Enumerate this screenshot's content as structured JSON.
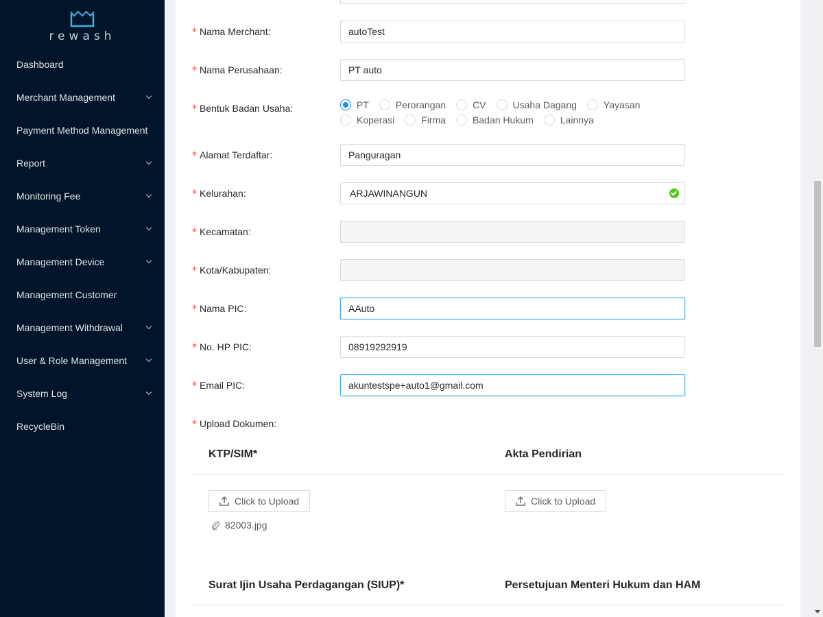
{
  "brand": {
    "name": "rewash",
    "color": "#3db2e6"
  },
  "sidebar": {
    "items": [
      {
        "label": "Dashboard",
        "expandable": false
      },
      {
        "label": "Merchant Management",
        "expandable": true
      },
      {
        "label": "Payment Method Management",
        "expandable": false
      },
      {
        "label": "Report",
        "expandable": true
      },
      {
        "label": "Monitoring Fee",
        "expandable": true
      },
      {
        "label": "Management Token",
        "expandable": true
      },
      {
        "label": "Management Device",
        "expandable": true
      },
      {
        "label": "Management Customer",
        "expandable": false
      },
      {
        "label": "Management Withdrawal",
        "expandable": true
      },
      {
        "label": "User & Role Management",
        "expandable": true
      },
      {
        "label": "System Log",
        "expandable": true
      },
      {
        "label": "RecycleBin",
        "expandable": false
      }
    ]
  },
  "form": {
    "required_mark": "*",
    "fields": {
      "nama_merchant": {
        "label": "Nama Merchant",
        "value": "autoTest"
      },
      "nama_perusahaan": {
        "label": "Nama Perusahaan",
        "value": "PT auto"
      },
      "bentuk_badan_usaha": {
        "label": "Bentuk Badan Usaha",
        "options_row1": [
          "PT",
          "Perorangan",
          "CV",
          "Usaha Dagang",
          "Yayasan"
        ],
        "options_row2": [
          "Koperasi",
          "Firma",
          "Badan Hukum",
          "Lainnya"
        ],
        "selected": "PT"
      },
      "alamat_terdaftar": {
        "label": "Alamat Terdaftar",
        "value": "Panguragan"
      },
      "kelurahan": {
        "label": "Kelurahan",
        "value": "ARJAWINANGUN"
      },
      "kecamatan": {
        "label": "Kecamatan",
        "value": ""
      },
      "kota_kabupaten": {
        "label": "Kota/Kabupaten",
        "value": ""
      },
      "nama_pic": {
        "label": "Nama PIC",
        "value": "AAuto"
      },
      "no_hp_pic": {
        "label": "No. HP PIC",
        "value": "08919292919"
      },
      "email_pic": {
        "label": "Email PIC",
        "value": "akuntestspe+auto1@gmail.com"
      },
      "upload_dokumen": {
        "label": "Upload Dokumen"
      }
    },
    "uploads": {
      "ktp": {
        "title": "KTP/SIM*",
        "button": "Click to Upload",
        "file": "82003.jpg"
      },
      "akta": {
        "title": "Akta Pendirian",
        "button": "Click to Upload"
      },
      "siup": {
        "title": "Surat Ijin Usaha Perdagangan (SIUP)*"
      },
      "kemenkumham": {
        "title": "Persetujuan Menteri Hukum dan HAM"
      }
    }
  }
}
